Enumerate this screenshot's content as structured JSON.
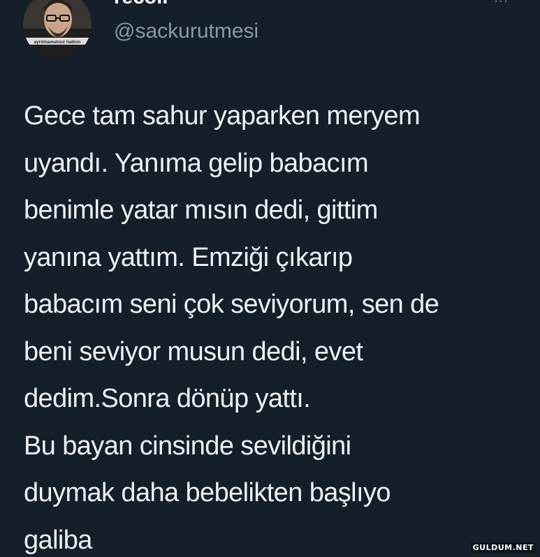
{
  "colors": {
    "background": "#141f2a",
    "text": "#eef1f4",
    "handle": "#8b98a5"
  },
  "user": {
    "display_name": "recoil",
    "handle": "@sackurutmesi",
    "avatar_caption": "ayrılmamalısız halkım"
  },
  "more_icon": "more-horizontal-icon",
  "more_glyph": "…",
  "tweet": {
    "lines": [
      "Gece tam sahur yaparken meryem",
      "uyandı. Yanıma gelip babacım",
      "benimle yatar mısın dedi, gittim",
      "yanına yattım. Emziği çıkarıp",
      "babacım seni çok seviyorum, sen de",
      "beni seviyor musun dedi, evet",
      "dedim.Sonra dönüp yattı.",
      "Bu bayan cinsinde sevildiğini",
      "duymak daha bebelikten başlıyo",
      "galiba"
    ]
  },
  "watermark": "GULDUM.NET"
}
